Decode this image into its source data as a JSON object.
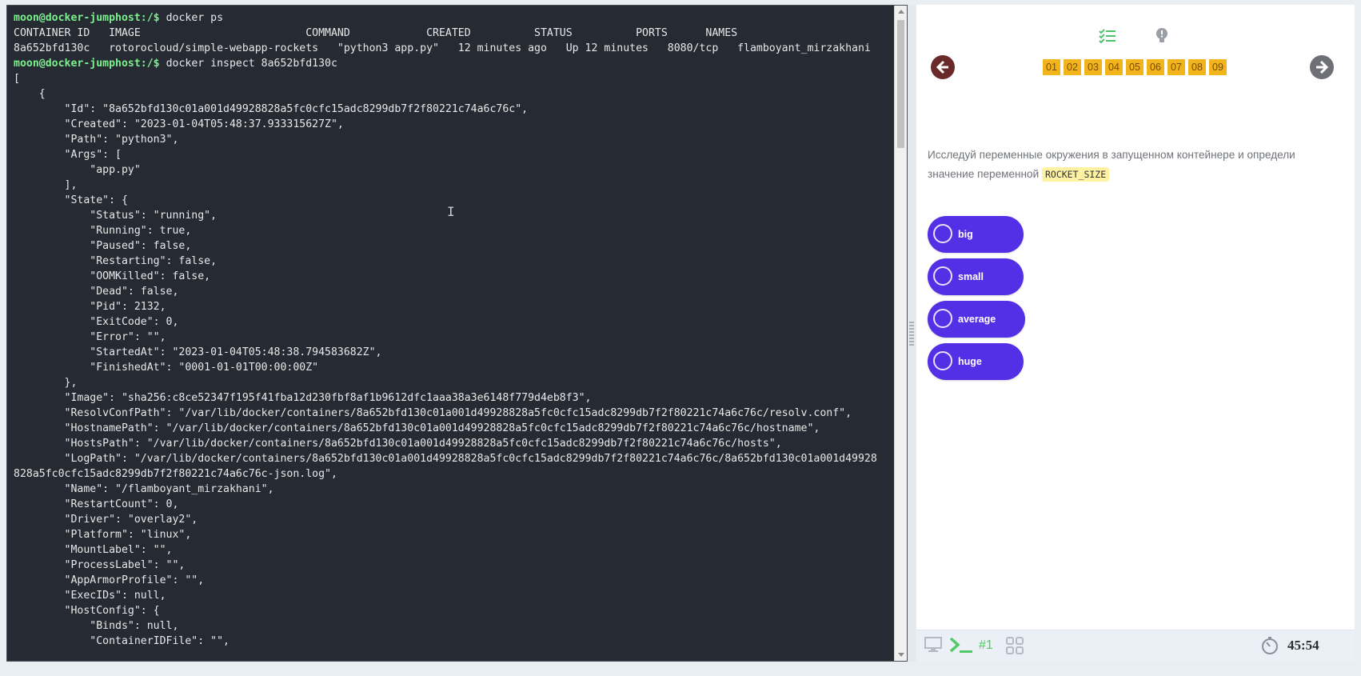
{
  "terminal": {
    "lines": [
      {
        "prompt": "moon@docker-jumphost:/$",
        "text": " docker ps"
      },
      {
        "prompt": "",
        "text": "CONTAINER ID   IMAGE                          COMMAND            CREATED          STATUS          PORTS      NAMES"
      },
      {
        "prompt": "",
        "text": "8a652bfd130c   rotorocloud/simple-webapp-rockets   \"python3 app.py\"   12 minutes ago   Up 12 minutes   8080/tcp   flamboyant_mirzakhani"
      },
      {
        "prompt": "moon@docker-jumphost:/$",
        "text": " docker inspect 8a652bfd130c"
      },
      {
        "prompt": "",
        "text": "["
      },
      {
        "prompt": "",
        "text": "    {"
      },
      {
        "prompt": "",
        "text": "        \"Id\": \"8a652bfd130c01a001d49928828a5fc0cfc15adc8299db7f2f80221c74a6c76c\","
      },
      {
        "prompt": "",
        "text": "        \"Created\": \"2023-01-04T05:48:37.933315627Z\","
      },
      {
        "prompt": "",
        "text": "        \"Path\": \"python3\","
      },
      {
        "prompt": "",
        "text": "        \"Args\": ["
      },
      {
        "prompt": "",
        "text": "            \"app.py\""
      },
      {
        "prompt": "",
        "text": "        ],"
      },
      {
        "prompt": "",
        "text": "        \"State\": {"
      },
      {
        "prompt": "",
        "text": "            \"Status\": \"running\","
      },
      {
        "prompt": "",
        "text": "            \"Running\": true,"
      },
      {
        "prompt": "",
        "text": "            \"Paused\": false,"
      },
      {
        "prompt": "",
        "text": "            \"Restarting\": false,"
      },
      {
        "prompt": "",
        "text": "            \"OOMKilled\": false,"
      },
      {
        "prompt": "",
        "text": "            \"Dead\": false,"
      },
      {
        "prompt": "",
        "text": "            \"Pid\": 2132,"
      },
      {
        "prompt": "",
        "text": "            \"ExitCode\": 0,"
      },
      {
        "prompt": "",
        "text": "            \"Error\": \"\","
      },
      {
        "prompt": "",
        "text": "            \"StartedAt\": \"2023-01-04T05:48:38.794583682Z\","
      },
      {
        "prompt": "",
        "text": "            \"FinishedAt\": \"0001-01-01T00:00:00Z\""
      },
      {
        "prompt": "",
        "text": "        },"
      },
      {
        "prompt": "",
        "text": "        \"Image\": \"sha256:c8ce52347f195f41fba12d230fbf8af1b9612dfc1aaa38a3e6148f779d4eb8f3\","
      },
      {
        "prompt": "",
        "text": "        \"ResolvConfPath\": \"/var/lib/docker/containers/8a652bfd130c01a001d49928828a5fc0cfc15adc8299db7f2f80221c74a6c76c/resolv.conf\","
      },
      {
        "prompt": "",
        "text": "        \"HostnamePath\": \"/var/lib/docker/containers/8a652bfd130c01a001d49928828a5fc0cfc15adc8299db7f2f80221c74a6c76c/hostname\","
      },
      {
        "prompt": "",
        "text": "        \"HostsPath\": \"/var/lib/docker/containers/8a652bfd130c01a001d49928828a5fc0cfc15adc8299db7f2f80221c74a6c76c/hosts\","
      },
      {
        "prompt": "",
        "text": "        \"LogPath\": \"/var/lib/docker/containers/8a652bfd130c01a001d49928828a5fc0cfc15adc8299db7f2f80221c74a6c76c/8a652bfd130c01a001d49928"
      },
      {
        "prompt": "",
        "text": "828a5fc0cfc15adc8299db7f2f80221c74a6c76c-json.log\","
      },
      {
        "prompt": "",
        "text": "        \"Name\": \"/flamboyant_mirzakhani\","
      },
      {
        "prompt": "",
        "text": "        \"RestartCount\": 0,"
      },
      {
        "prompt": "",
        "text": "        \"Driver\": \"overlay2\","
      },
      {
        "prompt": "",
        "text": "        \"Platform\": \"linux\","
      },
      {
        "prompt": "",
        "text": "        \"MountLabel\": \"\","
      },
      {
        "prompt": "",
        "text": "        \"ProcessLabel\": \"\","
      },
      {
        "prompt": "",
        "text": "        \"AppArmorProfile\": \"\","
      },
      {
        "prompt": "",
        "text": "        \"ExecIDs\": null,"
      },
      {
        "prompt": "",
        "text": "        \"HostConfig\": {"
      },
      {
        "prompt": "",
        "text": "            \"Binds\": null,"
      },
      {
        "prompt": "",
        "text": "            \"ContainerIDFile\": \"\","
      }
    ]
  },
  "panel": {
    "tabs": {
      "tasks_icon": "checklist-icon",
      "hint_icon": "lightbulb-icon"
    },
    "nav": {
      "prev_icon": "arrow-left-icon",
      "next_icon": "arrow-right-icon"
    },
    "steps": [
      "01",
      "02",
      "03",
      "04",
      "05",
      "06",
      "07",
      "08",
      "09"
    ],
    "question": {
      "text": "Исследуй переменные окружения в запущенном контейнере и определи значение переменной",
      "code": "ROCKET_SIZE"
    },
    "answers": [
      "big",
      "small",
      "average",
      "huge"
    ],
    "status_bar": {
      "session_label": "#1",
      "timer": "45:54"
    }
  },
  "colors": {
    "terminal_bg": "#262a33",
    "prompt": "#7bf08d",
    "step_bg": "#f2b41c",
    "answer_bg": "#5330e6",
    "prev_btn": "#6b2a2a",
    "next_btn": "#6f6f78",
    "highlight": "#fff3a3"
  }
}
